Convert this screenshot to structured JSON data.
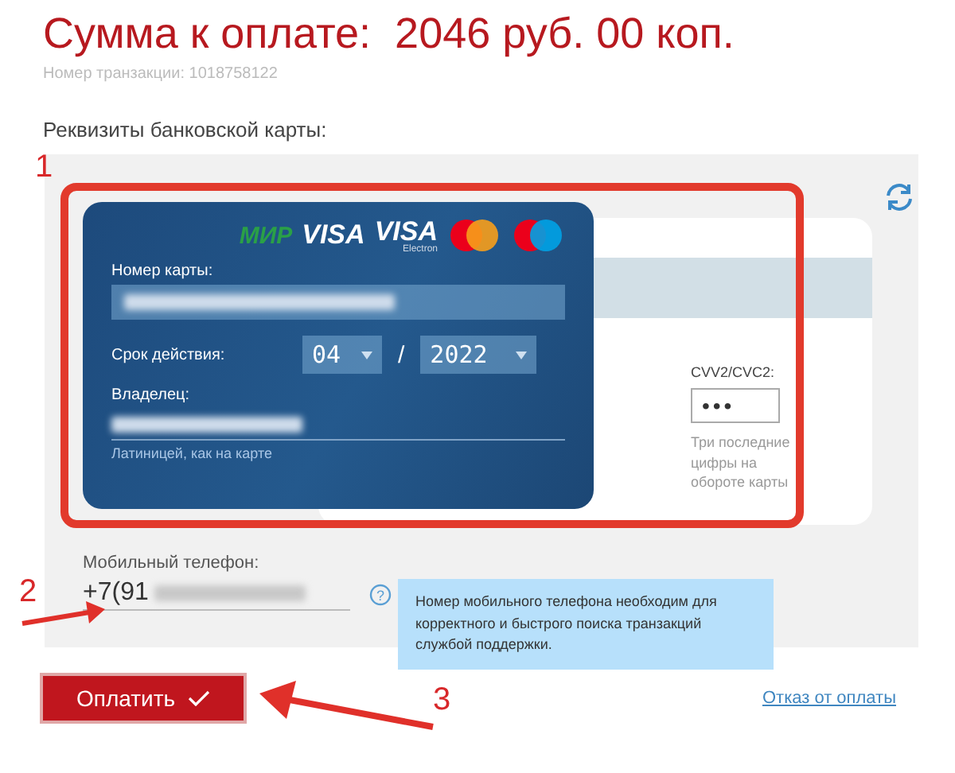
{
  "header": {
    "title": "Сумма к оплате:  2046 руб. 00 коп.",
    "transaction": "Номер транзакции: 1018758122"
  },
  "section_title": "Реквизиты банковской карты:",
  "card": {
    "brands": [
      {
        "kind": "mir",
        "label": "МИР"
      },
      {
        "kind": "visa",
        "label": "VISA"
      },
      {
        "kind": "visa_electron",
        "label": "VISA",
        "sublabel": "Electron"
      },
      {
        "kind": "mastercard"
      },
      {
        "kind": "maestro"
      }
    ],
    "number_label": "Номер карты:",
    "expiry_label": "Срок действия:",
    "expiry_month": "04",
    "expiry_separator": "/",
    "expiry_year": "2022",
    "holder_label": "Владелец:",
    "holder_hint": "Латиницей, как на карте",
    "cvv_label": "CVV2/CVC2:",
    "cvv_value": "•••",
    "cvv_hint": "Три последние цифры на обороте карты"
  },
  "phone": {
    "label": "Мобильный телефон:",
    "value": "+7(91",
    "help": "?",
    "tooltip": "Номер мобильного телефона необходим для корректного и быстрого поиска транзакций службой поддержки."
  },
  "pay_button": "Оплатить",
  "cancel_link": "Отказ от оплаты",
  "annotations": [
    {
      "label": "1"
    },
    {
      "label": "2"
    },
    {
      "label": "3"
    }
  ]
}
